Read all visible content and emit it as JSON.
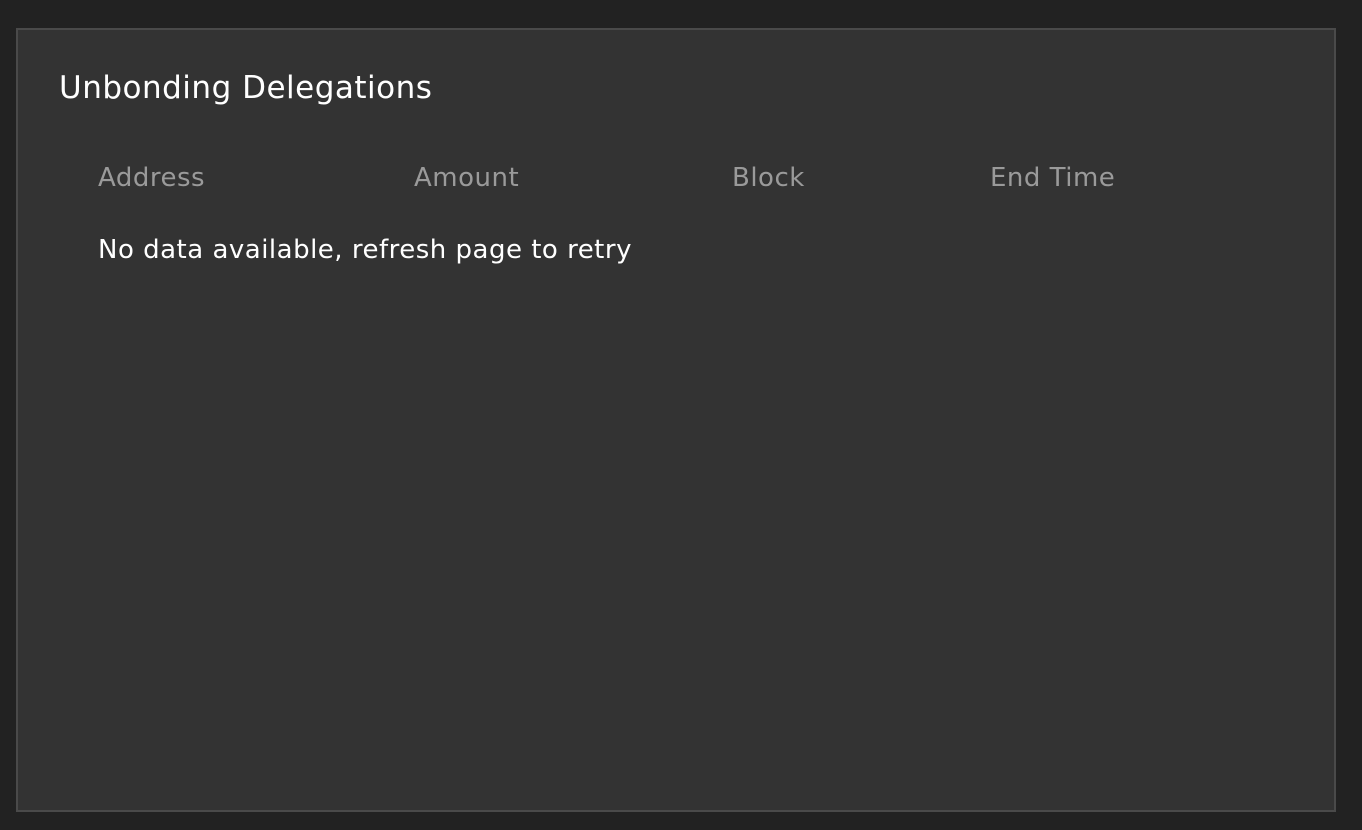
{
  "card": {
    "title": "Unbonding Delegations"
  },
  "table": {
    "columns": [
      "Address",
      "Amount",
      "Block",
      "End Time"
    ],
    "rows": [],
    "empty_message": "No data available, refresh page to retry"
  },
  "colors": {
    "page_background": "#222222",
    "card_background": "#333333",
    "card_border": "#4a4a4a",
    "header_text": "#9a9a9a",
    "body_text": "#ffffff"
  }
}
